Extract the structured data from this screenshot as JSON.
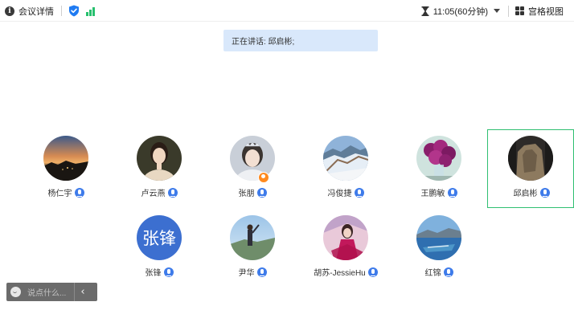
{
  "topbar": {
    "meeting_details": "会议详情",
    "meeting_details_icon": "info-icon",
    "security_icon": "shield-check-icon",
    "network_icon": "signal-strength-icon",
    "timer_icon": "hourglass-icon",
    "time_text": "11:05(60分钟)",
    "view_icon": "grid-view-icon",
    "view_label": "宫格视图",
    "colors": {
      "shield": "#1f7bf2",
      "signal": "#27c06e"
    }
  },
  "speaking": {
    "text": "正在讲话: 邱启彬;"
  },
  "participants": [
    {
      "name": "杨仁宇",
      "avatar": "sunset-landscape-photo",
      "mic": "on"
    },
    {
      "name": "卢云燕",
      "avatar": "portrait-woman-photo",
      "mic": "on"
    },
    {
      "name": "张朋",
      "avatar": "portrait-crown-photo",
      "mic": "on",
      "host": true
    },
    {
      "name": "冯俊捷",
      "avatar": "great-wall-photo",
      "mic": "on"
    },
    {
      "name": "王鹏敏",
      "avatar": "purple-flowers-photo",
      "mic": "on"
    },
    {
      "name": "邱启彬",
      "avatar": "rocky-landscape-photo",
      "mic": "on",
      "speaking": true
    },
    {
      "name": "张锋",
      "avatar_text": "张锋",
      "avatar_color": "#3c6fd0",
      "mic": "on"
    },
    {
      "name": "尹华",
      "avatar": "person-outdoors-photo",
      "mic": "on"
    },
    {
      "name": "胡苏-JessieHu",
      "avatar": "woman-pink-photo",
      "mic": "on"
    },
    {
      "name": "红锦",
      "avatar": "lake-boat-photo",
      "mic": "on"
    }
  ],
  "chat": {
    "placeholder": "说点什么...",
    "collapse_icon": "chevron-left-icon",
    "emoji_icon": "smile-icon"
  },
  "colors": {
    "active_border": "#2fbf71",
    "mic": "#3e7bea",
    "speaking_bg": "#d9e8fb"
  }
}
